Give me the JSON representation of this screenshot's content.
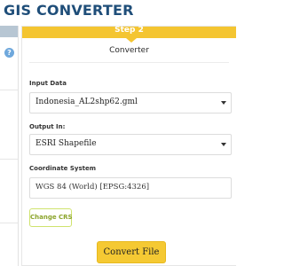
{
  "header": {
    "title": "GIS CONVERTER"
  },
  "left_panel": {
    "help_icon": "question-circle-icon"
  },
  "step": {
    "label": "Step 2",
    "title": "Converter",
    "banner_color": "#f4c531"
  },
  "form": {
    "input_data": {
      "label": "Input Data",
      "value": "Indonesia_AL2shp62.gml"
    },
    "output_in": {
      "label": "Output In:",
      "value": "ESRI Shapefile"
    },
    "coordinate_system": {
      "label": "Coordinate System",
      "value": "WGS 84 (World) [EPSG:4326]"
    },
    "change_crs_label": "Change CRS",
    "convert_label": "Convert File"
  },
  "colors": {
    "title": "#1f4e79",
    "accent_yellow": "#f5c933",
    "outline_green": "#8ba42b"
  }
}
